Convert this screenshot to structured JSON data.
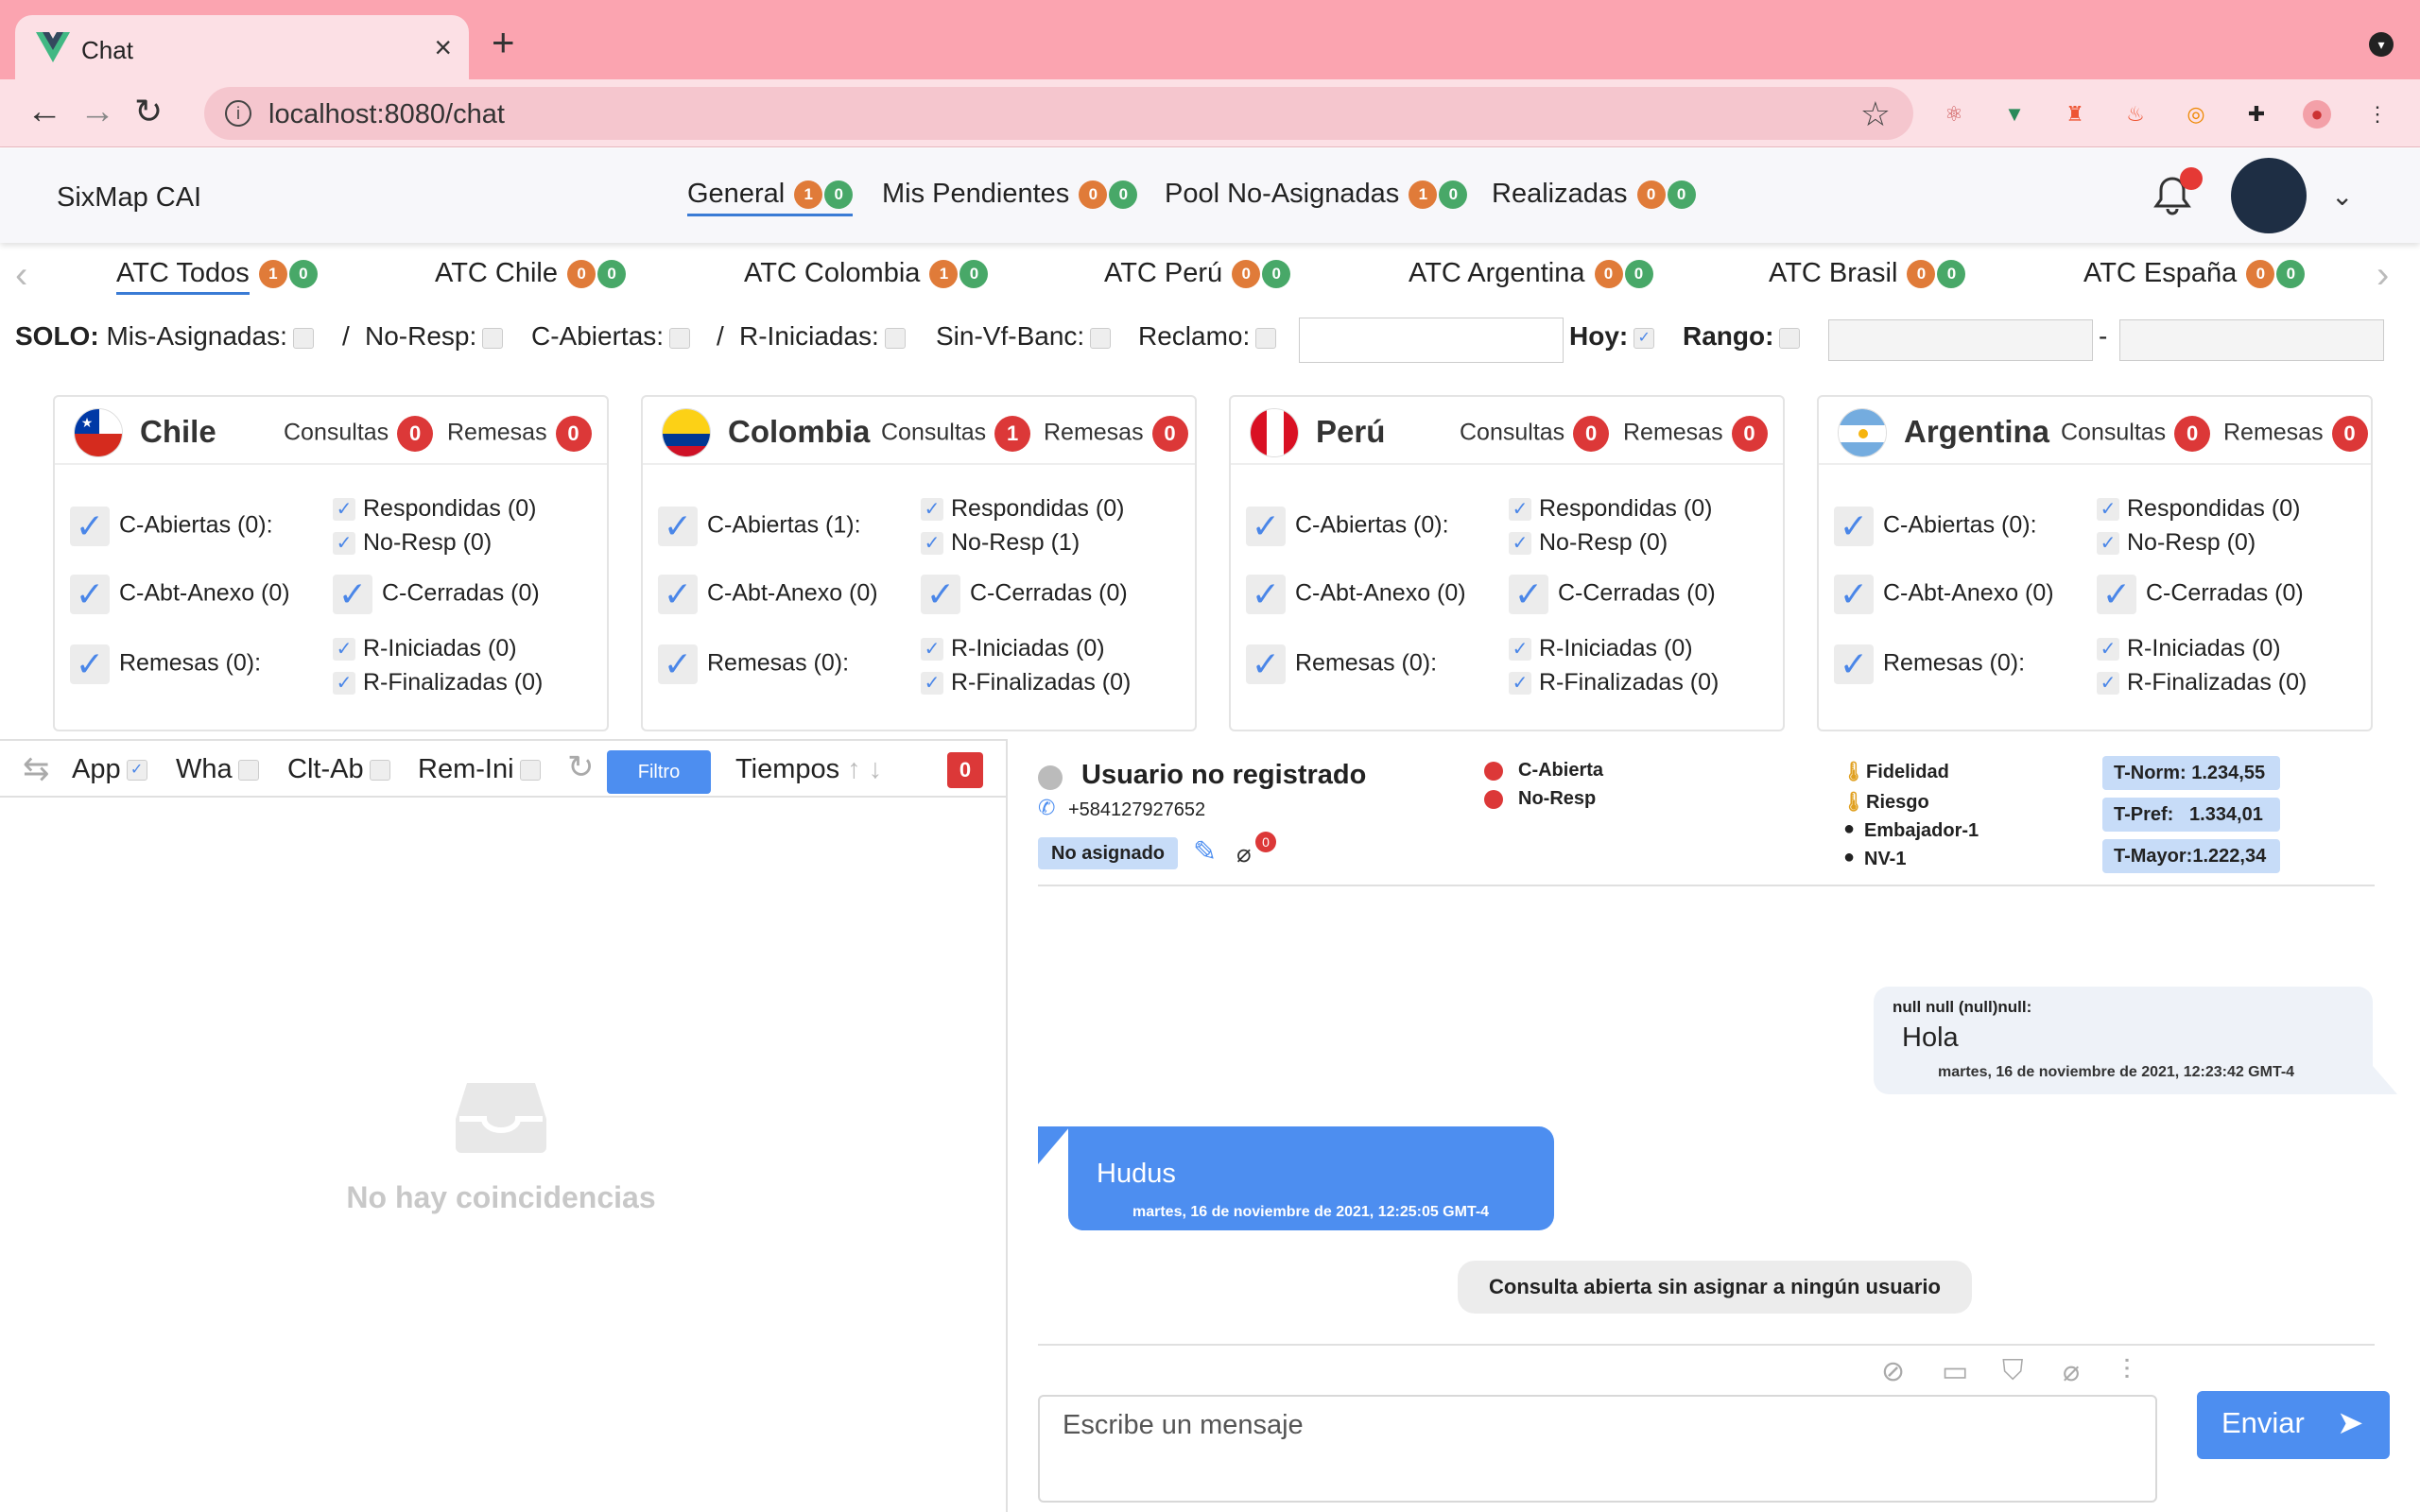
{
  "browser": {
    "tab_title": "Chat",
    "url": "localhost:8080/chat"
  },
  "header": {
    "brand": "SixMap CAI",
    "tabs": [
      {
        "label": "General",
        "orange": "1",
        "green": "0"
      },
      {
        "label": "Mis Pendientes",
        "orange": "0",
        "green": "0"
      },
      {
        "label": "Pool No-Asignadas",
        "orange": "1",
        "green": "0"
      },
      {
        "label": "Realizadas",
        "orange": "0",
        "green": "0"
      }
    ]
  },
  "country_tabs": [
    {
      "label": "ATC Todos",
      "orange": "1",
      "green": "0"
    },
    {
      "label": "ATC Chile",
      "orange": "0",
      "green": "0"
    },
    {
      "label": "ATC Colombia",
      "orange": "1",
      "green": "0"
    },
    {
      "label": "ATC Perú",
      "orange": "0",
      "green": "0"
    },
    {
      "label": "ATC Argentina",
      "orange": "0",
      "green": "0"
    },
    {
      "label": "ATC Brasil",
      "orange": "0",
      "green": "0"
    },
    {
      "label": "ATC España",
      "orange": "0",
      "green": "0"
    }
  ],
  "filters": {
    "solo": "SOLO:",
    "mis_asignadas": "Mis-Asignadas:",
    "sep1": "/",
    "no_resp": "No-Resp:",
    "c_abiertas": "C-Abiertas:",
    "sep2": "/",
    "r_iniciadas": "R-Iniciadas:",
    "sin_vf_banc": "Sin-Vf-Banc:",
    "reclamo": "Reclamo:",
    "hoy": "Hoy:",
    "rango": "Rango:",
    "dash": "-"
  },
  "cards": [
    {
      "name": "Chile",
      "consultas_label": "Consultas",
      "consultas": "0",
      "remesas_label": "Remesas",
      "remesas": "0",
      "c_abiertas": "C-Abiertas (0):",
      "c_abt_anexo": "C-Abt-Anexo (0)",
      "remesas_line": "Remesas (0):",
      "respondidas": "Respondidas (0)",
      "no_resp": "No-Resp (0)",
      "c_cerradas": "C-Cerradas (0)",
      "r_iniciadas": "R-Iniciadas (0)",
      "r_finalizadas": "R-Finalizadas (0)"
    },
    {
      "name": "Colombia",
      "consultas_label": "Consultas",
      "consultas": "1",
      "remesas_label": "Remesas",
      "remesas": "0",
      "c_abiertas": "C-Abiertas (1):",
      "c_abt_anexo": "C-Abt-Anexo (0)",
      "remesas_line": "Remesas (0):",
      "respondidas": "Respondidas (0)",
      "no_resp": "No-Resp (1)",
      "c_cerradas": "C-Cerradas (0)",
      "r_iniciadas": "R-Iniciadas (0)",
      "r_finalizadas": "R-Finalizadas (0)"
    },
    {
      "name": "Perú",
      "consultas_label": "Consultas",
      "consultas": "0",
      "remesas_label": "Remesas",
      "remesas": "0",
      "c_abiertas": "C-Abiertas (0):",
      "c_abt_anexo": "C-Abt-Anexo (0)",
      "remesas_line": "Remesas (0):",
      "respondidas": "Respondidas (0)",
      "no_resp": "No-Resp (0)",
      "c_cerradas": "C-Cerradas (0)",
      "r_iniciadas": "R-Iniciadas (0)",
      "r_finalizadas": "R-Finalizadas (0)"
    },
    {
      "name": "Argentina",
      "consultas_label": "Consultas",
      "consultas": "0",
      "remesas_label": "Remesas",
      "remesas": "0",
      "c_abiertas": "C-Abiertas (0):",
      "c_abt_anexo": "C-Abt-Anexo (0)",
      "remesas_line": "Remesas (0):",
      "respondidas": "Respondidas (0)",
      "no_resp": "No-Resp (0)",
      "c_cerradas": "C-Cerradas (0)",
      "r_iniciadas": "R-Iniciadas (0)",
      "r_finalizadas": "R-Finalizadas (0)"
    }
  ],
  "list_bar": {
    "app": "App",
    "wha": "Wha",
    "clt_ab": "Clt-Ab",
    "rem_ini": "Rem-Ini",
    "filtro": "Filtro",
    "tiempos": "Tiempos",
    "count": "0"
  },
  "empty_state": "No hay coincidencias",
  "contact": {
    "name": "Usuario no registrado",
    "phone": "+584127927652",
    "status_chip": "No asignado",
    "attach_count": "0",
    "flags": [
      "C-Abierta",
      "No-Resp"
    ],
    "tags": [
      "Fidelidad",
      "Riesgo",
      "Embajador-1",
      "NV-1"
    ],
    "times": [
      "T-Norm: 1.234,55",
      "T-Pref:   1.334,01",
      "T-Mayor:1.222,34"
    ]
  },
  "messages": [
    {
      "sender": "null null (null)null:",
      "text": "Hola",
      "time": "martes, 16 de noviembre de 2021, 12:23:42 GMT-4"
    },
    {
      "text": "Hudus",
      "time": "martes, 16 de noviembre de 2021, 12:25:05 GMT-4"
    }
  ],
  "system_note": "Consulta abierta sin asignar a ningún usuario",
  "composer": {
    "placeholder": "Escribe un mensaje",
    "send_label": "Enviar"
  },
  "colors": {
    "badge_orange": "#e07b39",
    "badge_green": "#48a868",
    "badge_red": "#dc3838",
    "accent_blue": "#4d8ef0",
    "browser_pink": "#fba4b0"
  }
}
